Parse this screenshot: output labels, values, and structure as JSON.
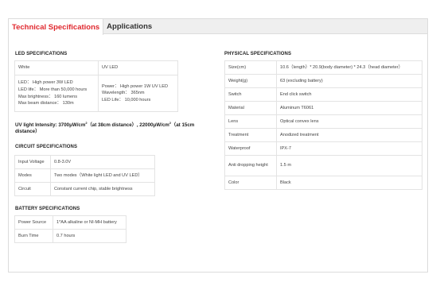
{
  "tabs": [
    {
      "label": "Technical Specifications",
      "active": true
    },
    {
      "label": "Applications",
      "active": false
    }
  ],
  "led": {
    "title": "LED SPECIFICATIONS",
    "header": [
      "White",
      "UV LED"
    ],
    "white_lines": [
      "LED： High power 3W LED",
      "LED life： More than 50,000 hours",
      "Max brightness： 160 lumens",
      "Max beam distance： 130m"
    ],
    "uv_lines": [
      "Power： High power 1W UV LED",
      "Wavelength： 365nm",
      "LED Life： 10,000 hours"
    ]
  },
  "uv_note": {
    "prefix": "UV light Intensity: 3700μW/cm",
    "mid": "（at 38cm distance）, 22000μW/cm",
    "suffix": "（at 15cm distance）",
    "sup": "2"
  },
  "circuit": {
    "title": "CIRCUIT SPECIFICATIONS",
    "rows": [
      [
        "Input Voltage",
        "0.8-3.0V"
      ],
      [
        "Modes",
        "Two modes（White light LED and UV LED）"
      ],
      [
        "Circuit",
        "Constant current chip, stable brightness"
      ]
    ]
  },
  "battery": {
    "title": "BATTERY SPECIFICATIONS",
    "rows": [
      [
        "Power Source",
        "1*AA alkaline or NI-MH battery"
      ],
      [
        "Burn Time",
        "0.7 hours"
      ]
    ]
  },
  "physical": {
    "title": "PHYSICAL SPECIFICATIONS",
    "rows": [
      [
        "Size(cm)",
        "10.6（length）* 20.9(body diameter) * 24.3（head diameter）"
      ],
      [
        "Weight(g)",
        "63 (excluding battery)"
      ],
      [
        "Switch",
        "End click switch"
      ],
      [
        "Material",
        "Aluminum T6061"
      ],
      [
        "Lens",
        "Optical convex lens"
      ],
      [
        "Treatment",
        "Anodized treatment"
      ],
      [
        "Waterproof",
        "IPX-7"
      ],
      [
        "Anti dropping height",
        "1.5 m"
      ],
      [
        "Color",
        "Black"
      ]
    ]
  }
}
